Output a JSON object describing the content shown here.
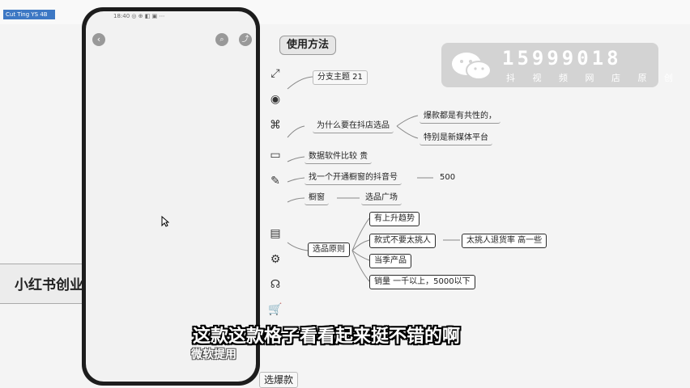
{
  "browser_tab": {
    "label": "Cut Ting YS 4B"
  },
  "mindmap": {
    "header": "使用方法",
    "branch_topic": "分支主题 21",
    "why_node": "为什么要在抖店选品",
    "why_children": [
      "爆款都是有共性的，",
      "特别是新媒体平台"
    ],
    "data_software": "数据软件比较 贵",
    "find_account": "找一个开通橱窗的抖音号",
    "find_account_value": "500",
    "showcase": "橱窗",
    "showcase_child": "选品广场",
    "principle": "选品原则",
    "principle_children": [
      "有上升趋势",
      "款式不要太挑人",
      "当季产品",
      "销量 一千以上，5000以下"
    ],
    "picky_child": "太挑人退货率 高一些",
    "bottom_node": "选爆款",
    "left_card": "小红书创业"
  },
  "watermark": {
    "phone": "15999018",
    "sub": "抖 视 频 网 店 原 创"
  },
  "phone": {
    "status_text": "18:40 ◎ ⊕ ◧ ▣ ⋯",
    "back_icon": "‹",
    "search_icon": "⌕",
    "share_icon": "⤴",
    "bottom_caption": "微软提用"
  },
  "toolbar_icons": [
    "⤢",
    "◉",
    "⌘",
    "▭",
    "✎",
    "▤",
    "⚙",
    "☊",
    "🛒"
  ],
  "subtitle": "这款这款格子看看起来挺不错的啊",
  "colors": {
    "accent_tab": "#3d78c4",
    "phone_bezel": "#1d1d1d",
    "watermark_bg": "#d3d3d3"
  }
}
